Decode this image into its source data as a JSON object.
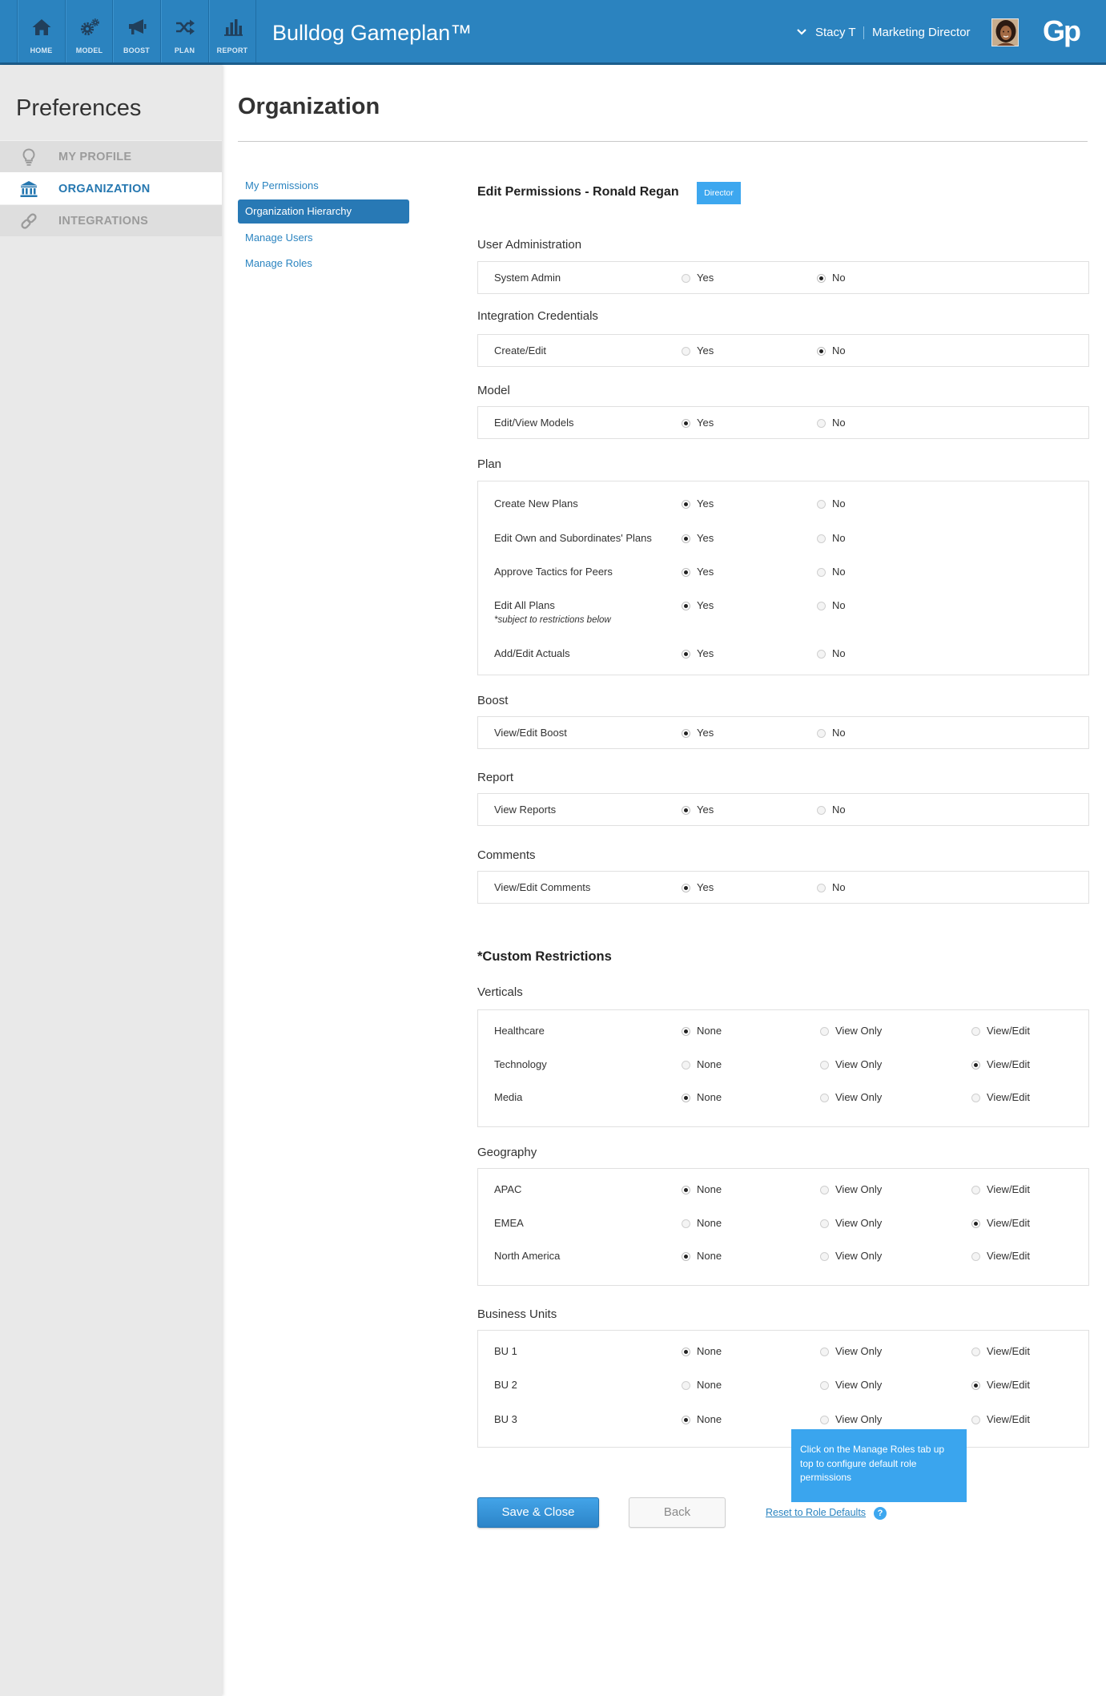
{
  "header": {
    "nav": [
      {
        "label": "HOME",
        "icon": "home-icon"
      },
      {
        "label": "MODEL",
        "icon": "gears-icon"
      },
      {
        "label": "BOOST",
        "icon": "megaphone-icon"
      },
      {
        "label": "PLAN",
        "icon": "shuffle-icon"
      },
      {
        "label": "REPORT",
        "icon": "bar-chart-icon"
      }
    ],
    "app_title": "Bulldog Gameplan™",
    "user_name": "Stacy T",
    "user_role": "Marketing Director",
    "logo_text": "Gp"
  },
  "sidebar": {
    "title": "Preferences",
    "items": [
      {
        "label": "MY PROFILE",
        "icon": "lightbulb-icon",
        "active": false
      },
      {
        "label": "ORGANIZATION",
        "icon": "bank-icon",
        "active": true
      },
      {
        "label": "INTEGRATIONS",
        "icon": "link-icon",
        "active": false
      }
    ]
  },
  "main": {
    "title": "Organization",
    "subnav": [
      {
        "label": "My Permissions",
        "active": false
      },
      {
        "label": "Organization Hierarchy",
        "active": true
      },
      {
        "label": "Manage Users",
        "active": false
      },
      {
        "label": "Manage Roles",
        "active": false
      }
    ],
    "edit_title": "Edit Permissions - Ronald Regan",
    "role_badge": "Director",
    "permissions": [
      {
        "title": "User Administration",
        "rows": [
          {
            "label": "System Admin",
            "options": [
              {
                "label": "Yes",
                "selected": false
              },
              {
                "label": "No",
                "selected": true
              }
            ]
          }
        ]
      },
      {
        "title": "Integration Credentials",
        "rows": [
          {
            "label": "Create/Edit",
            "options": [
              {
                "label": "Yes",
                "selected": false
              },
              {
                "label": "No",
                "selected": true
              }
            ]
          }
        ]
      },
      {
        "title": "Model",
        "rows": [
          {
            "label": "Edit/View Models",
            "options": [
              {
                "label": "Yes",
                "selected": true
              },
              {
                "label": "No",
                "selected": false
              }
            ]
          }
        ]
      },
      {
        "title": "Plan",
        "rows": [
          {
            "label": "Create New Plans",
            "options": [
              {
                "label": "Yes",
                "selected": true
              },
              {
                "label": "No",
                "selected": false
              }
            ]
          },
          {
            "label": "Edit Own and Subordinates' Plans",
            "options": [
              {
                "label": "Yes",
                "selected": true
              },
              {
                "label": "No",
                "selected": false
              }
            ]
          },
          {
            "label": "Approve Tactics for Peers",
            "options": [
              {
                "label": "Yes",
                "selected": true
              },
              {
                "label": "No",
                "selected": false
              }
            ]
          },
          {
            "label": "Edit All Plans",
            "note": "*subject to restrictions below",
            "options": [
              {
                "label": "Yes",
                "selected": true
              },
              {
                "label": "No",
                "selected": false
              }
            ]
          },
          {
            "label": "Add/Edit Actuals",
            "options": [
              {
                "label": "Yes",
                "selected": true
              },
              {
                "label": "No",
                "selected": false
              }
            ]
          }
        ]
      },
      {
        "title": "Boost",
        "rows": [
          {
            "label": "View/Edit Boost",
            "options": [
              {
                "label": "Yes",
                "selected": true
              },
              {
                "label": "No",
                "selected": false
              }
            ]
          }
        ]
      },
      {
        "title": "Report",
        "rows": [
          {
            "label": "View Reports",
            "options": [
              {
                "label": "Yes",
                "selected": true
              },
              {
                "label": "No",
                "selected": false
              }
            ]
          }
        ]
      },
      {
        "title": "Comments",
        "rows": [
          {
            "label": "View/Edit Comments",
            "options": [
              {
                "label": "Yes",
                "selected": true
              },
              {
                "label": "No",
                "selected": false
              }
            ]
          }
        ]
      }
    ],
    "restrictions_title": "*Custom Restrictions",
    "restrictions": [
      {
        "title": "Verticals",
        "rows": [
          {
            "label": "Healthcare",
            "options": [
              {
                "label": "None",
                "selected": true
              },
              {
                "label": "View Only",
                "selected": false
              },
              {
                "label": "View/Edit",
                "selected": false
              }
            ]
          },
          {
            "label": "Technology",
            "options": [
              {
                "label": "None",
                "selected": false
              },
              {
                "label": "View Only",
                "selected": false
              },
              {
                "label": "View/Edit",
                "selected": true
              }
            ]
          },
          {
            "label": "Media",
            "options": [
              {
                "label": "None",
                "selected": true
              },
              {
                "label": "View Only",
                "selected": false
              },
              {
                "label": "View/Edit",
                "selected": false
              }
            ]
          }
        ]
      },
      {
        "title": "Geography",
        "rows": [
          {
            "label": "APAC",
            "options": [
              {
                "label": "None",
                "selected": true
              },
              {
                "label": "View Only",
                "selected": false
              },
              {
                "label": "View/Edit",
                "selected": false
              }
            ]
          },
          {
            "label": "EMEA",
            "options": [
              {
                "label": "None",
                "selected": false
              },
              {
                "label": "View Only",
                "selected": false
              },
              {
                "label": "View/Edit",
                "selected": true
              }
            ]
          },
          {
            "label": "North America",
            "options": [
              {
                "label": "None",
                "selected": true
              },
              {
                "label": "View Only",
                "selected": false
              },
              {
                "label": "View/Edit",
                "selected": false
              }
            ]
          }
        ]
      },
      {
        "title": "Business Units",
        "rows": [
          {
            "label": "BU 1",
            "options": [
              {
                "label": "None",
                "selected": true
              },
              {
                "label": "View Only",
                "selected": false
              },
              {
                "label": "View/Edit",
                "selected": false
              }
            ]
          },
          {
            "label": "BU 2",
            "options": [
              {
                "label": "None",
                "selected": false
              },
              {
                "label": "View Only",
                "selected": false
              },
              {
                "label": "View/Edit",
                "selected": true
              }
            ]
          },
          {
            "label": "BU 3",
            "options": [
              {
                "label": "None",
                "selected": true
              },
              {
                "label": "View Only",
                "selected": false
              },
              {
                "label": "View/Edit",
                "selected": false
              }
            ]
          }
        ]
      }
    ],
    "tooltip": "Click on the Manage Roles tab up top to configure default role permissions",
    "save_label": "Save & Close",
    "back_label": "Back",
    "reset_label": "Reset to Role Defaults",
    "help_label": "?"
  },
  "colors": {
    "header": "#2b83bf",
    "accent": "#2b84c0",
    "badge": "#3da7ef",
    "tooltip": "#3aa5ee",
    "sidebar": "#e9e9e9"
  }
}
